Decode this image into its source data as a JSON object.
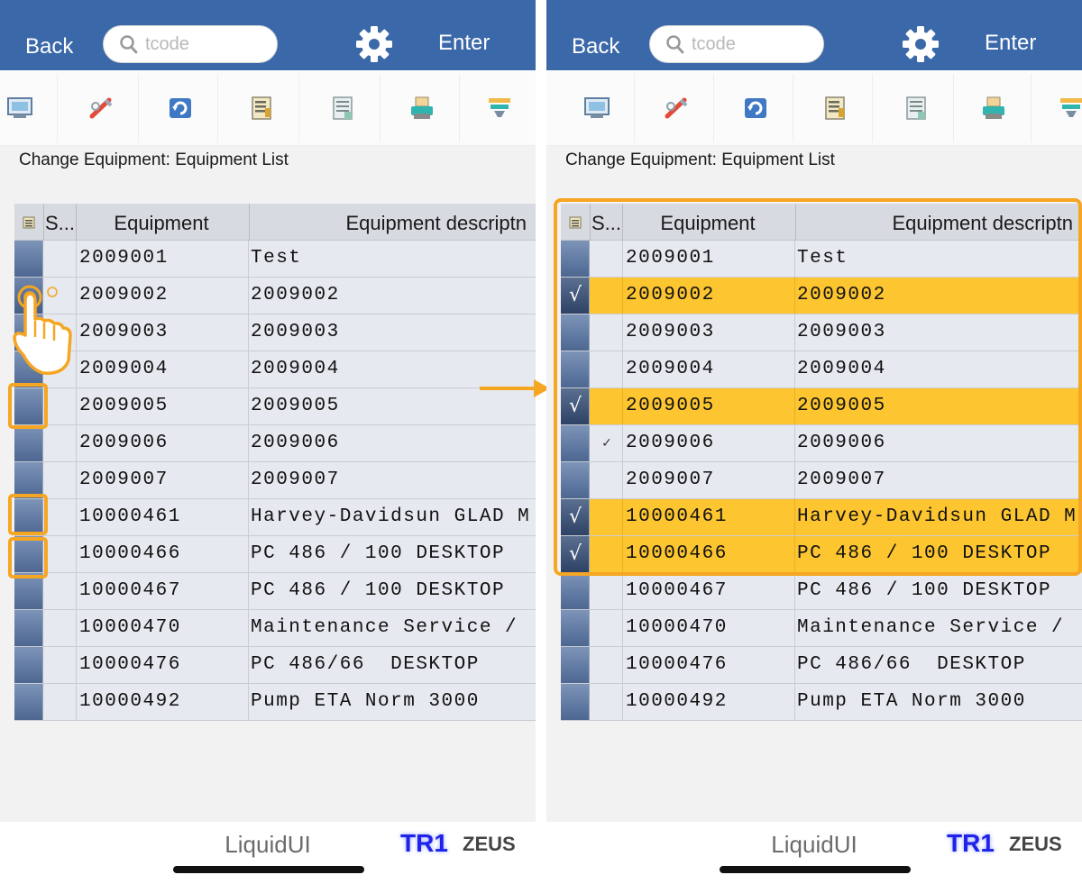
{
  "topbar": {
    "back_label": "Back",
    "search_placeholder": "tcode",
    "enter_label": "Enter"
  },
  "toolbar": {
    "icons": [
      "display-icon",
      "edit-pencil-icon",
      "refresh-icon",
      "detail-list-icon",
      "document-icon",
      "print-icon",
      "filter-icon"
    ]
  },
  "screen": {
    "title": "Change Equipment: Equipment List"
  },
  "grid": {
    "columns": [
      "S...",
      "Equipment",
      "Equipment descriptn"
    ],
    "rows": [
      {
        "equipment": "2009001",
        "description": "Test"
      },
      {
        "equipment": "2009002",
        "description": "2009002"
      },
      {
        "equipment": "2009003",
        "description": "2009003"
      },
      {
        "equipment": "2009004",
        "description": "2009004"
      },
      {
        "equipment": "2009005",
        "description": "2009005"
      },
      {
        "equipment": "2009006",
        "description": "2009006"
      },
      {
        "equipment": "2009007",
        "description": "2009007"
      },
      {
        "equipment": "10000461",
        "description": "Harvey-Davidsun GLAD M"
      },
      {
        "equipment": "10000466",
        "description": "PC 486 / 100 DESKTOP"
      },
      {
        "equipment": "10000467",
        "description": "PC 486 / 100 DESKTOP"
      },
      {
        "equipment": "10000470",
        "description": "Maintenance Service / "
      },
      {
        "equipment": "10000476",
        "description": "PC 486/66  DESKTOP"
      },
      {
        "equipment": "10000492",
        "description": "Pump ETA Norm 3000"
      }
    ],
    "selected_after": [
      false,
      true,
      false,
      false,
      true,
      false,
      false,
      true,
      true,
      false,
      false,
      false,
      false
    ],
    "status_marks_after": [
      "",
      "",
      "",
      "",
      "",
      "✓",
      "",
      "",
      "",
      "",
      "",
      "",
      ""
    ],
    "check_glyph": "√"
  },
  "footer": {
    "brand": "LiquidUI",
    "system": "TR1",
    "server": "ZEUS"
  },
  "colors": {
    "header_blue": "#3a68a8",
    "selection_yellow": "#fdc630",
    "highlight_orange": "#f5a623",
    "row_bg": "#e6e9ef",
    "system_blue": "#1f22e8"
  }
}
